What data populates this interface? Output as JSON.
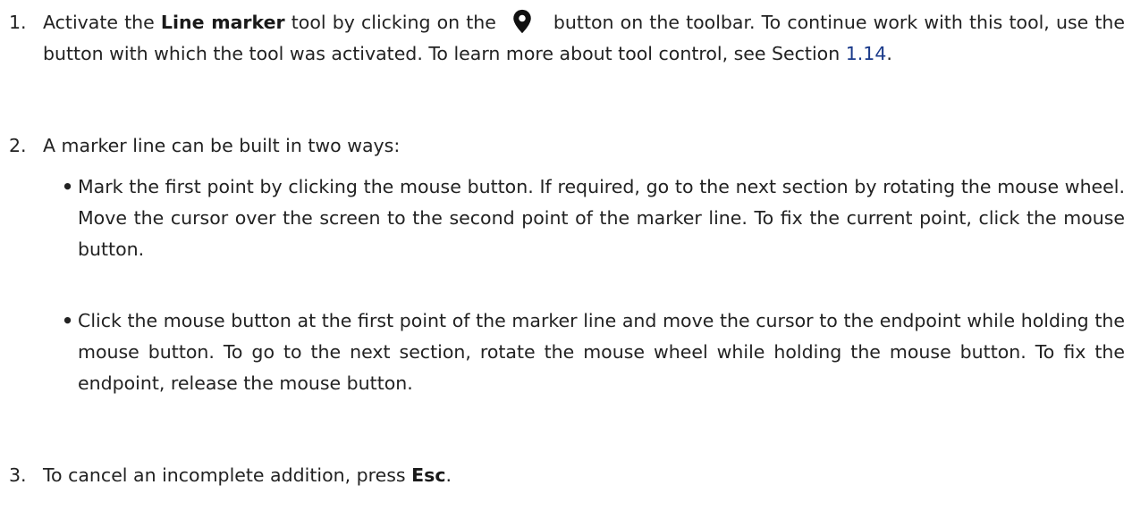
{
  "steps": [
    {
      "number": "1.",
      "text_a": "Activate the ",
      "bold_a": "Line marker",
      "text_b": " tool by clicking on the",
      "icon": "map-marker-icon",
      "text_c": "button on the toolbar. To continue work with this tool, use the button with which the tool was activated. To learn more about tool control, see Section ",
      "link": "1.14",
      "text_d": "."
    },
    {
      "number": "2.",
      "text": "A marker line can be built in two ways:",
      "bullets": [
        "Mark the first point by clicking the mouse button. If required, go to the next section by rotating the mouse wheel. Move the cursor over the screen to the second point of the marker line. To fix the current point, click the mouse button.",
        "Click the mouse button at the first point of the marker line and move the cursor to the endpoint while holding the mouse button. To go to the next section, rotate the mouse wheel while holding the mouse button. To fix the endpoint, release the mouse button."
      ]
    },
    {
      "number": "3.",
      "text_a": "To cancel an incomplete addition, press ",
      "bold_a": "Esc",
      "text_b": "."
    }
  ],
  "bullet_symbol": "•",
  "colors": {
    "text": "#222222",
    "link": "#1a3a8a",
    "icon": "#111111"
  }
}
